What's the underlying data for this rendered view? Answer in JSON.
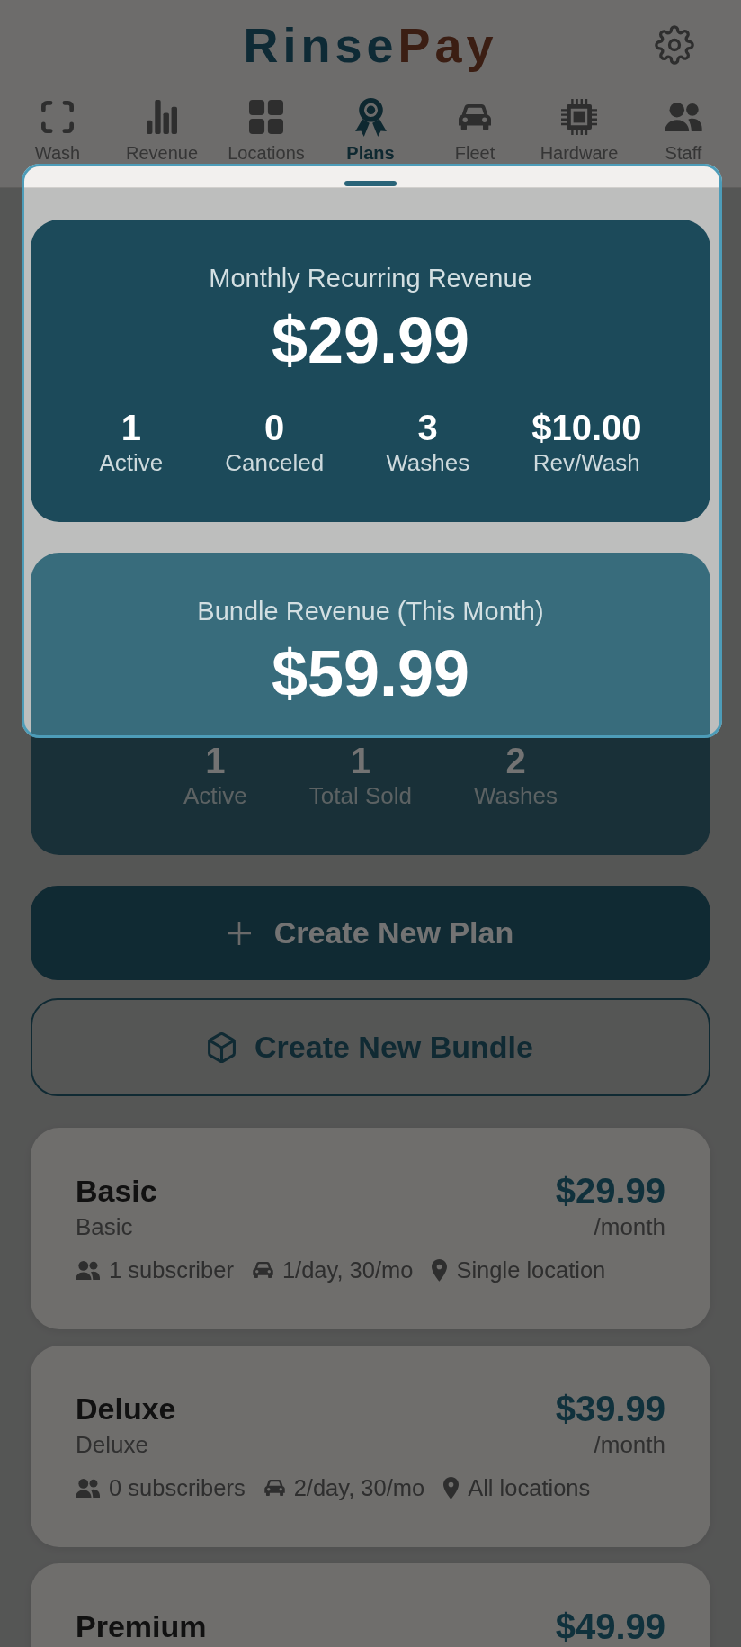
{
  "app_bar": {
    "logo_primary": "Rinse",
    "logo_accent": "Pay"
  },
  "tabs": [
    {
      "label": "Wash",
      "selected": false
    },
    {
      "label": "Revenue",
      "selected": false
    },
    {
      "label": "Locations",
      "selected": false
    },
    {
      "label": "Plans",
      "selected": true
    },
    {
      "label": "Fleet",
      "selected": false
    },
    {
      "label": "Hardware",
      "selected": false
    },
    {
      "label": "Staff",
      "selected": false
    }
  ],
  "revenue_cards": [
    {
      "kind": "subscriptions",
      "title": "Monthly Recurring Revenue",
      "value": "$29.99",
      "stats": [
        {
          "value": "1",
          "label": "Active"
        },
        {
          "value": "0",
          "label": "Canceled"
        },
        {
          "value": "3",
          "label": "Washes"
        },
        {
          "value": "$10.00",
          "label": "Rev/Wash"
        }
      ]
    },
    {
      "kind": "bundles",
      "title": "Bundle Revenue (This Month)",
      "value": "$59.99",
      "stats": [
        {
          "value": "1",
          "label": "Active"
        },
        {
          "value": "1",
          "label": "Total Sold"
        },
        {
          "value": "2",
          "label": "Washes"
        }
      ]
    }
  ],
  "actions": [
    {
      "kind": "plan",
      "label": "Create New Plan"
    },
    {
      "kind": "bundle",
      "label": "Create New Bundle"
    }
  ],
  "plans": [
    {
      "name": "Basic",
      "description": "Basic",
      "price": "$29.99",
      "period": "/month",
      "subscribers": "1 subscriber",
      "wash_limit": "1/day, 30/mo",
      "coverage": "Single location"
    },
    {
      "name": "Deluxe",
      "description": "Deluxe",
      "price": "$39.99",
      "period": "/month",
      "subscribers": "0 subscribers",
      "wash_limit": "2/day, 30/mo",
      "coverage": "All locations"
    },
    {
      "name": "Premium",
      "price": "$49.99"
    }
  ]
}
